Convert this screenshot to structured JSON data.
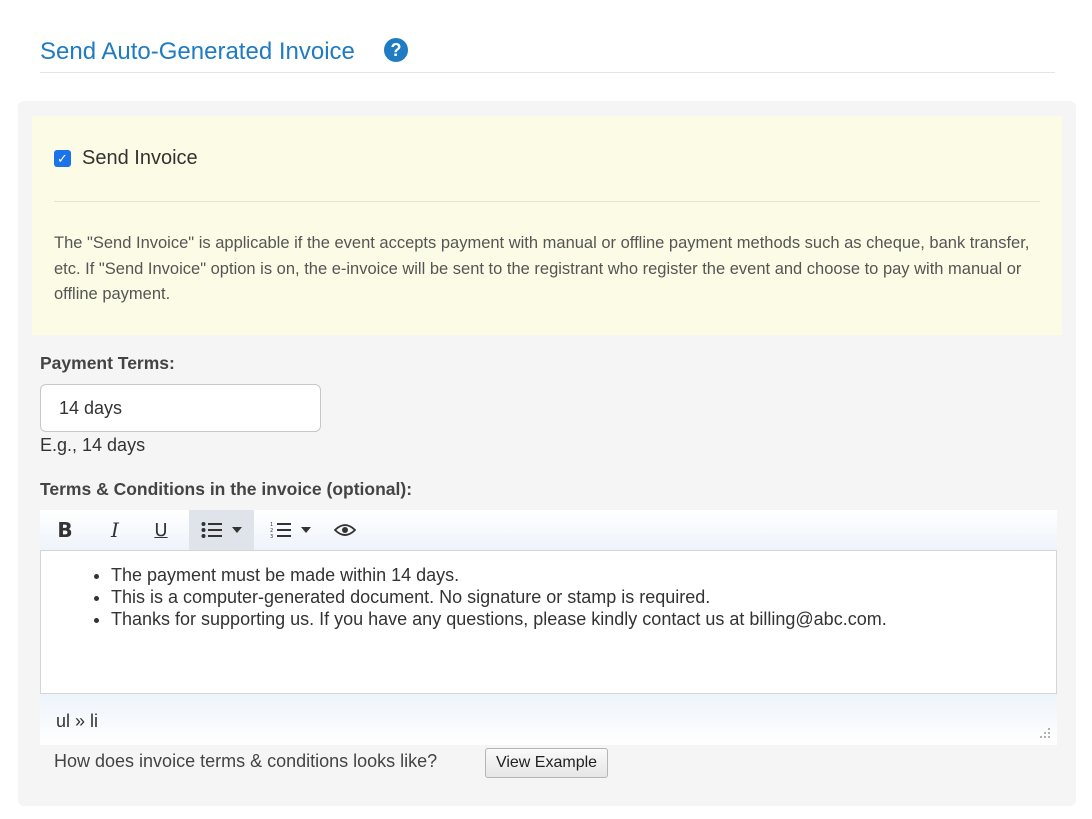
{
  "header": {
    "title": "Send Auto-Generated Invoice",
    "help_icon": "?"
  },
  "notice": {
    "checkbox_label": "Send Invoice",
    "checked": true,
    "description": "The \"Send Invoice\" is applicable if the event accepts payment with manual or offline payment methods such as cheque, bank transfer, etc. If \"Send Invoice\" option is on, the e-invoice will be sent to the registrant who register the event and choose to pay with manual or offline payment."
  },
  "payment_terms": {
    "label": "Payment Terms:",
    "value": "14 days",
    "hint": "E.g., 14 days"
  },
  "terms_conditions": {
    "label": "Terms & Conditions in the invoice (optional):",
    "toolbar": {
      "bold": "B",
      "italic": "I",
      "underline": "U",
      "icons": [
        "bold-icon",
        "italic-icon",
        "underline-icon",
        "bullet-list-icon",
        "numbered-list-icon",
        "eye-icon"
      ]
    },
    "items": [
      "The payment must be made within 14 days.",
      "This is a computer-generated document. No signature or stamp is required.",
      "Thanks for supporting us. If you have any questions, please kindly contact us at billing@abc.com."
    ],
    "path": "ul » li"
  },
  "example": {
    "question": "How does invoice terms & conditions looks like?",
    "button": "View Example"
  },
  "colors": {
    "accent": "#1f7bc2",
    "notice_bg": "#fcfce6",
    "panel_bg": "#f5f5f5",
    "checkbox": "#1a73e8"
  }
}
